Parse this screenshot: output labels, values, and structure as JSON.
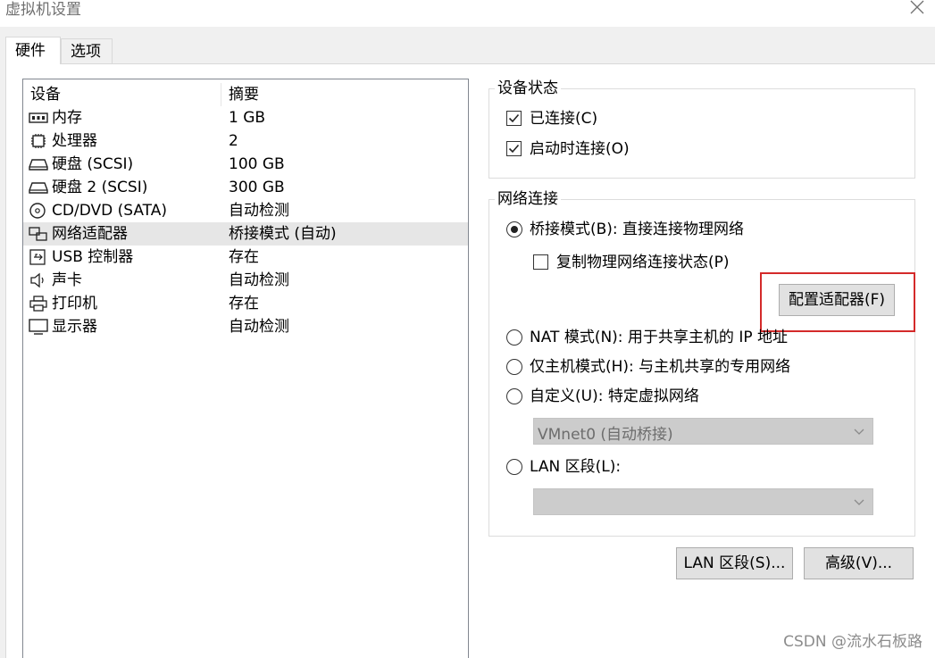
{
  "window": {
    "title": "虚拟机设置"
  },
  "tabs": [
    {
      "label": "硬件"
    },
    {
      "label": "选项"
    }
  ],
  "device_list": {
    "columns": {
      "device": "设备",
      "summary": "摘要"
    },
    "rows": [
      {
        "icon": "memory-icon",
        "name": "内存",
        "summary": "1 GB"
      },
      {
        "icon": "processor-icon",
        "name": "处理器",
        "summary": "2"
      },
      {
        "icon": "hard-disk-icon",
        "name": "硬盘 (SCSI)",
        "summary": "100 GB"
      },
      {
        "icon": "hard-disk-icon",
        "name": "硬盘 2 (SCSI)",
        "summary": "300 GB"
      },
      {
        "icon": "cd-dvd-icon",
        "name": "CD/DVD (SATA)",
        "summary": "自动检测"
      },
      {
        "icon": "network-adapter-icon",
        "name": "网络适配器",
        "summary": "桥接模式 (自动)",
        "selected": true
      },
      {
        "icon": "usb-icon",
        "name": "USB 控制器",
        "summary": "存在"
      },
      {
        "icon": "sound-card-icon",
        "name": "声卡",
        "summary": "自动检测"
      },
      {
        "icon": "printer-icon",
        "name": "打印机",
        "summary": "存在"
      },
      {
        "icon": "display-icon",
        "name": "显示器",
        "summary": "自动检测"
      }
    ]
  },
  "device_status": {
    "title": "设备状态",
    "connected": {
      "label": "已连接(C)",
      "checked": true
    },
    "connect_at_power_on": {
      "label": "启动时连接(O)",
      "checked": true
    }
  },
  "network_connection": {
    "title": "网络连接",
    "bridged": {
      "label": "桥接模式(B): 直接连接物理网络",
      "selected": true
    },
    "replicate_state": {
      "label": "复制物理网络连接状态(P)",
      "checked": false
    },
    "configure_adapters_button": "配置适配器(F)",
    "nat": {
      "label": "NAT 模式(N): 用于共享主机的 IP 地址",
      "selected": false
    },
    "host_only": {
      "label": "仅主机模式(H): 与主机共享的专用网络",
      "selected": false
    },
    "custom": {
      "label": "自定义(U): 特定虚拟网络",
      "selected": false
    },
    "custom_select_value": "VMnet0 (自动桥接)",
    "lan_segment": {
      "label": "LAN 区段(L):",
      "selected": false
    },
    "lan_segment_select_value": ""
  },
  "buttons": {
    "lan_segments": "LAN 区段(S)...",
    "advanced": "高级(V)..."
  },
  "watermark": "CSDN @流水石板路",
  "colors": {
    "highlight_border": "#d42a2a",
    "selected_row": "#e6e6e6"
  }
}
